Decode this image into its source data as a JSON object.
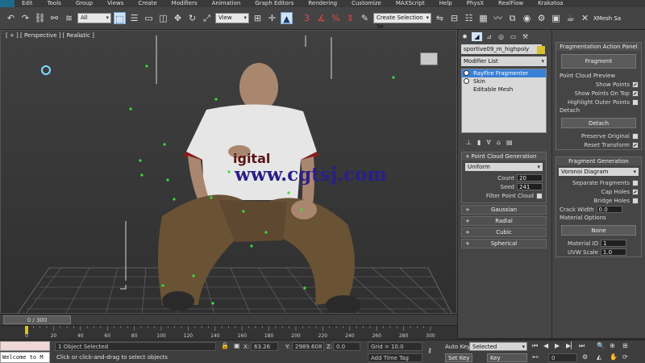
{
  "menubar": {
    "items": [
      "Edit",
      "Tools",
      "Group",
      "Views",
      "Create",
      "Modifiers",
      "Animation",
      "Graph Editors",
      "Rendering",
      "Customize",
      "MAXScript",
      "Help",
      "PhysX",
      "RealFlow",
      "Krakatoa"
    ]
  },
  "toolbar": {
    "filter_value": "All",
    "view_value": "View",
    "selection_set_value": "Create Selection Se",
    "xmesh_label": "XMesh Sa"
  },
  "viewport": {
    "label": "[ + ] [ Perspective ] [ Realistic ]",
    "watermark": "www.cgtsj.com",
    "shirt_text": "igital"
  },
  "command_panel": {
    "object_name": "sportive09_m_highpoly",
    "modifier_list": "Modifier List",
    "stack": [
      "RayFire Fragmenter",
      "Skin",
      "Editable Mesh"
    ],
    "pointcloud": {
      "title": "Point Cloud Generation",
      "type": "Uniform",
      "count_label": "Count",
      "count_value": "20",
      "seed_label": "Seed",
      "seed_value": "241",
      "filter_label": "Filter Point Cloud"
    },
    "rollouts": [
      "Gaussian",
      "Radial",
      "Cubic",
      "Spherical"
    ],
    "collapsed_sign": "+"
  },
  "fragmentation": {
    "panel_title": "Fragmentation Action Panel",
    "fragment_button": "Fragment",
    "preview_title": "Point Cloud Preview",
    "show_points": "Show Points",
    "show_points_on_top": "Show Points On Top",
    "highlight_outer": "Highlight Outer Points",
    "detach_title": "Detach",
    "detach_button": "Detach",
    "preserve_original": "Preserve Original",
    "reset_transform": "Reset Transform",
    "generation_title": "Fragment Generation",
    "method": "Voronoi Diagram",
    "separate_fragments": "Separate Fragments",
    "cap_holes": "Cap Holes",
    "bridge_holes": "Bridge Holes",
    "crack_width_label": "Crack Width",
    "crack_width_value": "0.0",
    "material_options": "Material Options",
    "material_none": "None",
    "material_id_label": "Material ID",
    "material_id_value": "1",
    "uvw_scale_label": "UVW Scale",
    "uvw_scale_value": "1.0",
    "checked": "✔"
  },
  "timeline": {
    "frame_display": "0 / 300",
    "ticks": [
      "0",
      "20",
      "40",
      "60",
      "80",
      "100",
      "120",
      "140",
      "160",
      "180",
      "200",
      "220",
      "240",
      "260",
      "280",
      "300"
    ]
  },
  "status": {
    "maxscript_input": "",
    "listener_text": "Welcome to M",
    "selected": "1 Object Selected",
    "prompt": "Click or click-and-drag to select objects",
    "x_label": "X:",
    "x_value": "63.26",
    "y_label": "Y:",
    "y_value": "2989.608",
    "z_label": "Z:",
    "z_value": "0.0",
    "grid": "Grid = 10.0",
    "add_time_tag": "Add Time Tag",
    "auto_key": "Auto Key",
    "set_key": "Set Key",
    "selected_dd": "Selected",
    "key_filters": "Key Filters...",
    "frame_value": "0"
  },
  "colors": {
    "accent": "#3a7fd6",
    "watermark": "#2a1f8a",
    "point": "#38e038"
  }
}
